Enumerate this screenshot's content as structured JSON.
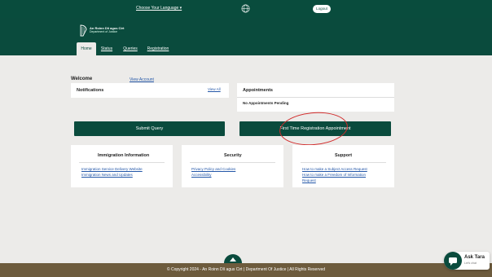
{
  "topbar": {
    "language_label": "Choose Your Language ▾",
    "globe_icon": "globe-icon",
    "logout_label": "Logout"
  },
  "header": {
    "brand_line1": "An Roinn Dlí agus Cirt",
    "brand_line2": "Department of Justice",
    "nav": [
      "Home",
      "Status",
      "Queries",
      "Registration"
    ]
  },
  "welcome": {
    "text": "Welcome",
    "view_account": "View Account"
  },
  "notifications": {
    "title": "Notifications",
    "view_all": "View All"
  },
  "appointments": {
    "title": "Appointments",
    "status": "No Appointments Pending"
  },
  "buttons": {
    "submit_query": "Submit Query",
    "first_time": "First Time Registration Appointment"
  },
  "immigration": {
    "title": "Immigration Information",
    "links": [
      "Immigration Service Delivery Website",
      "Immigration News and Updates"
    ]
  },
  "security": {
    "title": "Security",
    "links": [
      "Privacy Policy and Cookies",
      "Accessibility"
    ]
  },
  "support": {
    "title": "Support",
    "links": [
      "How to make a Subject Access Request",
      "How to make a Freedom of Information",
      "Request"
    ]
  },
  "footer": {
    "text": "© Copyright 2024 - An Roinn Dlí agus Cirt | Department Of Justice | All Rights Reserved"
  },
  "chat": {
    "title": "Ask Tara",
    "subtitle": "Let's chat"
  },
  "colors": {
    "brand_green": "#0a4b3d",
    "footer_brown": "#6d5b3d",
    "link_blue": "#2457a8",
    "annotation_red": "#d22b2b"
  }
}
